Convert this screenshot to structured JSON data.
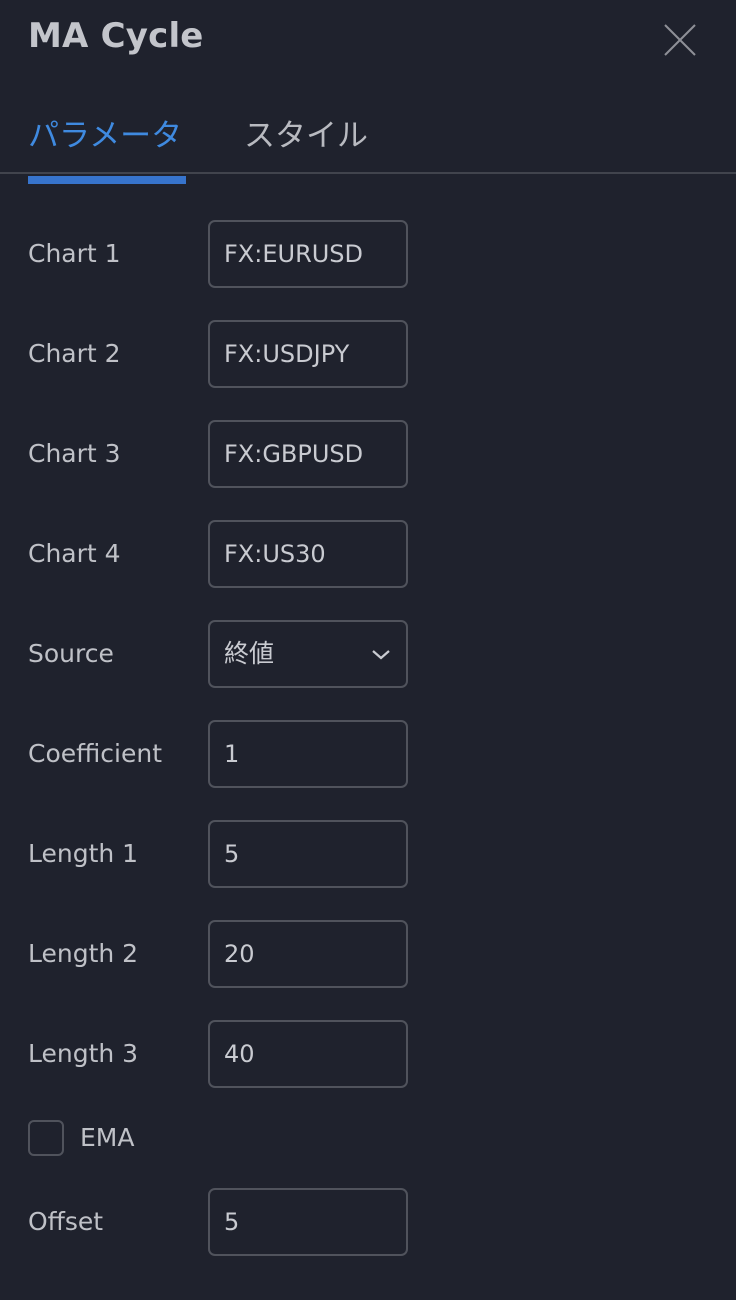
{
  "dialog": {
    "title": "MA Cycle",
    "close_icon": "close-icon"
  },
  "tabs": [
    {
      "label": "パラメータ",
      "active": true
    },
    {
      "label": "スタイル",
      "active": false
    }
  ],
  "colors": {
    "background": "#1f222d",
    "accent": "#3f8ae0",
    "border": "#50535c"
  },
  "fields": {
    "chart1": {
      "label": "Chart 1",
      "value": "FX:EURUSD"
    },
    "chart2": {
      "label": "Chart 2",
      "value": "FX:USDJPY"
    },
    "chart3": {
      "label": "Chart 3",
      "value": "FX:GBPUSD"
    },
    "chart4": {
      "label": "Chart 4",
      "value": "FX:US30"
    },
    "source": {
      "label": "Source",
      "value": "終値"
    },
    "coefficient": {
      "label": "Coefficient",
      "value": "1"
    },
    "length1": {
      "label": "Length 1",
      "value": "5"
    },
    "length2": {
      "label": "Length 2",
      "value": "20"
    },
    "length3": {
      "label": "Length 3",
      "value": "40"
    },
    "ema": {
      "label": "EMA",
      "checked": false
    },
    "offset": {
      "label": "Offset",
      "value": "5"
    }
  }
}
